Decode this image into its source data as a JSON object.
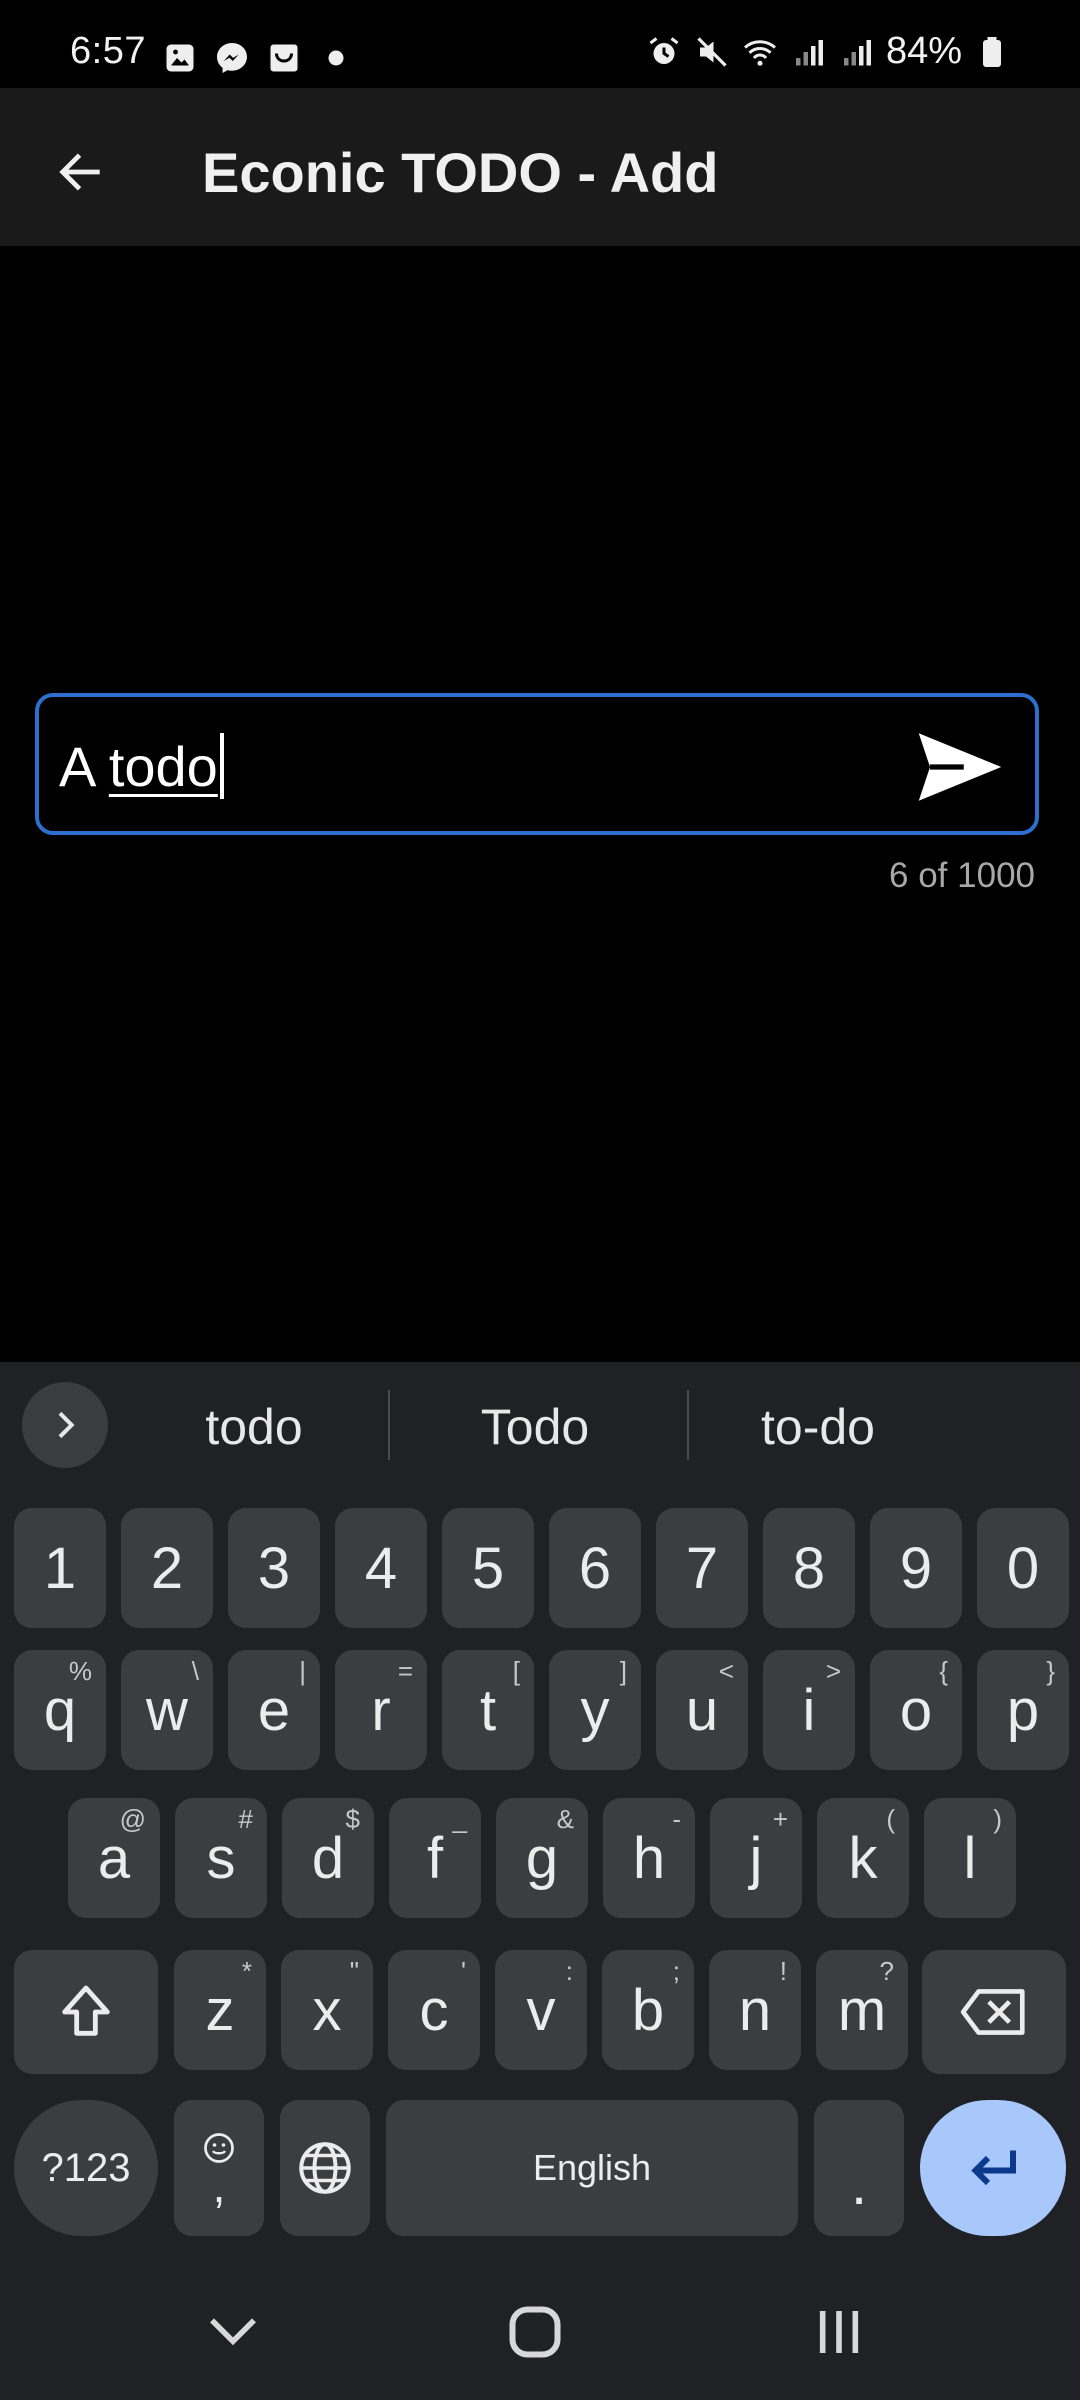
{
  "status_bar": {
    "time": "6:57",
    "battery": "84%",
    "left_icons": [
      "gallery-icon",
      "messenger-icon",
      "shop-icon",
      "dot-icon"
    ],
    "right_icons": [
      "alarm-icon",
      "mute-icon",
      "wifi-icon",
      "signal-icon",
      "signal-icon",
      "battery-icon"
    ]
  },
  "app_bar": {
    "title": "Econic TODO - Add",
    "back_icon": "arrow-left-icon"
  },
  "todo_input": {
    "value_plain": "A ",
    "value_underlined": "todo",
    "send_icon": "send-icon",
    "counter": "6 of 1000",
    "border_color": "#2c6fce"
  },
  "keyboard": {
    "suggestions": [
      "todo",
      "Todo",
      "to-do"
    ],
    "number_row": [
      "1",
      "2",
      "3",
      "4",
      "5",
      "6",
      "7",
      "8",
      "9",
      "0"
    ],
    "row1": [
      {
        "k": "q",
        "s": "%"
      },
      {
        "k": "w",
        "s": "\\"
      },
      {
        "k": "e",
        "s": "|"
      },
      {
        "k": "r",
        "s": "="
      },
      {
        "k": "t",
        "s": "["
      },
      {
        "k": "y",
        "s": "]"
      },
      {
        "k": "u",
        "s": "<"
      },
      {
        "k": "i",
        "s": ">"
      },
      {
        "k": "o",
        "s": "{"
      },
      {
        "k": "p",
        "s": "}"
      }
    ],
    "row2": [
      {
        "k": "a",
        "s": "@"
      },
      {
        "k": "s",
        "s": "#"
      },
      {
        "k": "d",
        "s": "$"
      },
      {
        "k": "f",
        "s": "_"
      },
      {
        "k": "g",
        "s": "&"
      },
      {
        "k": "h",
        "s": "-"
      },
      {
        "k": "j",
        "s": "+"
      },
      {
        "k": "k",
        "s": "("
      },
      {
        "k": "l",
        "s": ")"
      }
    ],
    "row3": [
      {
        "k": "z",
        "s": "*"
      },
      {
        "k": "x",
        "s": "\""
      },
      {
        "k": "c",
        "s": "'"
      },
      {
        "k": "v",
        "s": ":"
      },
      {
        "k": "b",
        "s": ";"
      },
      {
        "k": "n",
        "s": "!"
      },
      {
        "k": "m",
        "s": "?"
      }
    ],
    "symbols_label": "?123",
    "comma_label": ",",
    "space_label": "English",
    "period_label": ".",
    "accent_color": "#a8c7fa"
  },
  "nav_bar": {
    "icons": [
      "chevron-down-icon",
      "home-icon",
      "recents-icon"
    ]
  }
}
